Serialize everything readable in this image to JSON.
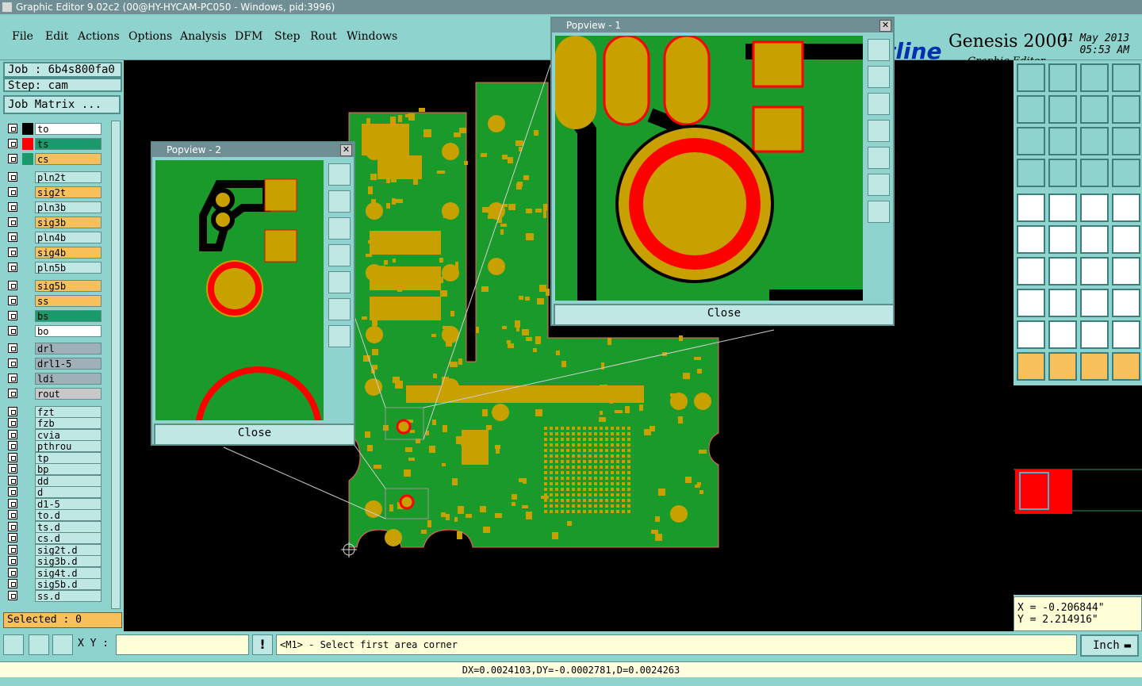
{
  "window": {
    "title": "Graphic Editor 9.02c2 (00@HY-HYCAM-PC050 - Windows, pid:3996)"
  },
  "menu": [
    "File",
    "Edit",
    "Actions",
    "Options",
    "Analysis",
    "DFM",
    "Step",
    "Rout",
    "Windows"
  ],
  "brand": {
    "logo": "tline",
    "product": "Genesis 2000",
    "subtitle": "Graphic Editor",
    "date": "11 May 2013",
    "time": "05:53 AM"
  },
  "job": {
    "job_label": "Job : 6b4s800fa0",
    "step_label": "Step: cam",
    "matrix_button": "Job Matrix ..."
  },
  "layers": [
    {
      "name": "to",
      "color": "#ffffff",
      "swatch": "#000000"
    },
    {
      "name": "ts",
      "color": "#1a9a6a",
      "swatch": "#ff0000"
    },
    {
      "name": "cs",
      "color": "#f8c05a",
      "swatch": "#1a9a6a"
    },
    {
      "name": "pln2t",
      "color": "#bfe7e4",
      "swatch": ""
    },
    {
      "name": "sig2t",
      "color": "#f8c05a",
      "swatch": ""
    },
    {
      "name": "pln3b",
      "color": "#bfe7e4",
      "swatch": ""
    },
    {
      "name": "sig3b",
      "color": "#f8c05a",
      "swatch": ""
    },
    {
      "name": "pln4b",
      "color": "#bfe7e4",
      "swatch": ""
    },
    {
      "name": "sig4b",
      "color": "#f8c05a",
      "swatch": ""
    },
    {
      "name": "pln5b",
      "color": "#bfe7e4",
      "swatch": ""
    },
    {
      "name": "sig5b",
      "color": "#f8c05a",
      "swatch": ""
    },
    {
      "name": "ss",
      "color": "#f8c05a",
      "swatch": ""
    },
    {
      "name": "bs",
      "color": "#1a9a6a",
      "swatch": ""
    },
    {
      "name": "bo",
      "color": "#ffffff",
      "swatch": ""
    },
    {
      "name": "drl",
      "color": "#a0b0b8",
      "swatch": ""
    },
    {
      "name": "drl1-5",
      "color": "#a0b0b8",
      "swatch": ""
    },
    {
      "name": "ldi",
      "color": "#a0b0b8",
      "swatch": ""
    },
    {
      "name": "rout",
      "color": "#c8c8c8",
      "swatch": ""
    },
    {
      "name": "fzt",
      "color": "#bfe7e4",
      "swatch": ""
    },
    {
      "name": "fzb",
      "color": "#bfe7e4",
      "swatch": ""
    },
    {
      "name": "cvia",
      "color": "#bfe7e4",
      "swatch": ""
    },
    {
      "name": "pthrou",
      "color": "#bfe7e4",
      "swatch": ""
    },
    {
      "name": "tp",
      "color": "#bfe7e4",
      "swatch": ""
    },
    {
      "name": "bp",
      "color": "#bfe7e4",
      "swatch": ""
    },
    {
      "name": "dd",
      "color": "#bfe7e4",
      "swatch": ""
    },
    {
      "name": "d",
      "color": "#bfe7e4",
      "swatch": ""
    },
    {
      "name": "d1-5",
      "color": "#bfe7e4",
      "swatch": ""
    },
    {
      "name": "to.d",
      "color": "#bfe7e4",
      "swatch": ""
    },
    {
      "name": "ts.d",
      "color": "#bfe7e4",
      "swatch": ""
    },
    {
      "name": "cs.d",
      "color": "#bfe7e4",
      "swatch": ""
    },
    {
      "name": "sig2t.d",
      "color": "#bfe7e4",
      "swatch": ""
    },
    {
      "name": "sig3b.d",
      "color": "#bfe7e4",
      "swatch": ""
    },
    {
      "name": "sig4t.d",
      "color": "#bfe7e4",
      "swatch": ""
    },
    {
      "name": "sig5b.d",
      "color": "#bfe7e4",
      "swatch": ""
    },
    {
      "name": "ss.d",
      "color": "#bfe7e4",
      "swatch": ""
    }
  ],
  "selected": "Selected : 0",
  "popview1": {
    "title": "Popview - 1",
    "close": "Close"
  },
  "popview2": {
    "title": "Popview - 2",
    "close": "Close"
  },
  "coords": {
    "x": "X = -0.206844\"",
    "y": "Y = 2.214916\""
  },
  "bottom": {
    "xy_label": "X Y :",
    "prompt": "<M1> - Select first area corner",
    "unit": "Inch"
  },
  "status": "DX=0.0024103,DY=-0.0002781,D=0.0024263",
  "colors": {
    "board": "#1a9a2a",
    "copper": "#c8a000",
    "pad_ring": "#ff0000",
    "background": "#000000"
  }
}
